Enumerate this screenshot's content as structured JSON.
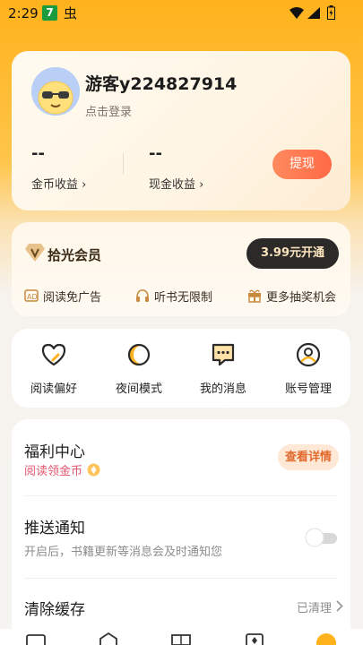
{
  "status_bar": {
    "time": "2:29",
    "app_badge": "7",
    "glyph": "虫"
  },
  "profile": {
    "username": "游客y224827914",
    "login_hint": "点击登录",
    "coin_value": "--",
    "coin_label": "金币收益 ›",
    "cash_value": "--",
    "cash_label": "现金收益 ›",
    "withdraw_label": "提现"
  },
  "vip": {
    "title": "拾光会员",
    "button_label": "3.99元开通",
    "perks": [
      {
        "icon": "ad-free-icon",
        "label": "阅读免广告"
      },
      {
        "icon": "headphones-icon",
        "label": "听书无限制"
      },
      {
        "icon": "gift-icon",
        "label": "更多抽奖机会"
      }
    ]
  },
  "quick_actions": [
    {
      "icon": "heart-icon",
      "label": "阅读偏好"
    },
    {
      "icon": "moon-icon",
      "label": "夜间模式"
    },
    {
      "icon": "message-icon",
      "label": "我的消息"
    },
    {
      "icon": "account-icon",
      "label": "账号管理"
    }
  ],
  "settings": {
    "welfare": {
      "title": "福利中心",
      "subtitle": "阅读领金币",
      "button_label": "查看详情"
    },
    "push": {
      "title": "推送通知",
      "subtitle": "开启后，书籍更新等消息会及时通知您",
      "enabled": false
    },
    "cache": {
      "title": "清除缓存",
      "status": "已清理"
    }
  },
  "colors": {
    "brand_orange": "#ffb21c",
    "withdraw": "#ff6a45",
    "vip_button": "#2b2a28",
    "welfare_text": "#e4576e",
    "detail_text": "#e0692d"
  }
}
